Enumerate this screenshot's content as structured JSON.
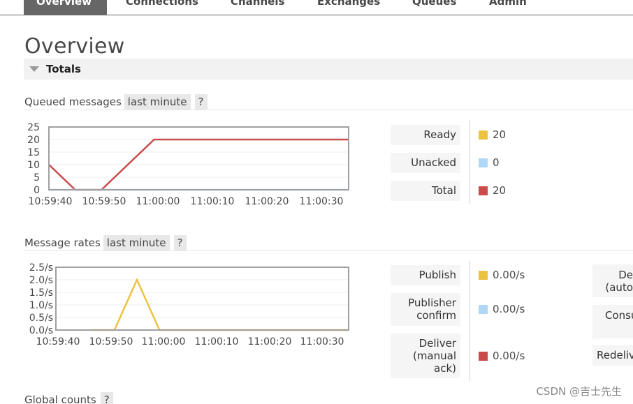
{
  "nav": {
    "tabs": [
      {
        "label": "Overview",
        "active": true
      },
      {
        "label": "Connections"
      },
      {
        "label": "Channels"
      },
      {
        "label": "Exchanges"
      },
      {
        "label": "Queues"
      },
      {
        "label": "Admin"
      }
    ]
  },
  "page": {
    "title": "Overview"
  },
  "totals": {
    "label": "Totals"
  },
  "queued": {
    "heading": "Queued messages",
    "range": "last minute",
    "help": "?",
    "legend": [
      {
        "label": "Ready",
        "value": "20",
        "color": "#edc240"
      },
      {
        "label": "Unacked",
        "value": "0",
        "color": "#afd8f8"
      },
      {
        "label": "Total",
        "value": "20",
        "color": "#cb4b4b"
      }
    ]
  },
  "rates": {
    "heading": "Message rates",
    "range": "last minute",
    "help": "?",
    "legend": [
      {
        "label": "Publish",
        "value": "0.00/s",
        "color": "#edc240"
      },
      {
        "label": "Publisher confirm",
        "label_lines": [
          "Publisher",
          "confirm"
        ],
        "value": "0.00/s",
        "color": "#afd8f8"
      },
      {
        "label": "Deliver (manual ack)",
        "label_lines": [
          "Deliver",
          "(manual",
          "ack)"
        ],
        "value": "0.00/s",
        "color": "#cb4b4b"
      }
    ],
    "cutoff_labels": [
      "De",
      "(auto",
      "Consu",
      "Redeliv"
    ]
  },
  "global": {
    "heading": "Global counts",
    "help": "?"
  },
  "watermark": "CSDN @吉士先生",
  "chart_data": [
    {
      "type": "line",
      "title": "Queued messages",
      "x": [
        "10:59:40",
        "10:59:45",
        "10:59:50",
        "11:00:00",
        "11:00:10",
        "11:00:20",
        "11:00:30",
        "11:00:37"
      ],
      "x_ticks": [
        "10:59:40",
        "10:59:50",
        "11:00:00",
        "11:00:10",
        "11:00:20",
        "11:00:30"
      ],
      "y_ticks": [
        "25",
        "20",
        "15",
        "10",
        "5",
        "0"
      ],
      "ylim": [
        0,
        25
      ],
      "series": [
        {
          "name": "Total",
          "color": "#cb4b4b",
          "points": [
            [
              "10:59:40",
              10
            ],
            [
              "10:59:45",
              0
            ],
            [
              "10:59:50",
              0
            ],
            [
              "11:00:00",
              20
            ],
            [
              "11:00:37",
              20
            ]
          ]
        },
        {
          "name": "Unacked",
          "color": "#afd8f8",
          "points": [
            [
              "10:59:40",
              0
            ],
            [
              "11:00:37",
              0
            ]
          ]
        }
      ],
      "grid": true
    },
    {
      "type": "line",
      "title": "Message rates",
      "x_ticks": [
        "10:59:40",
        "10:59:50",
        "11:00:00",
        "11:00:10",
        "11:00:20",
        "11:00:30"
      ],
      "y_ticks": [
        "2.5/s",
        "2.0/s",
        "1.5/s",
        "1.0/s",
        "0.5/s",
        "0.0/s"
      ],
      "ylim": [
        0,
        2.5
      ],
      "series": [
        {
          "name": "Publish",
          "color": "#edc240",
          "points": [
            [
              "10:59:40",
              0
            ],
            [
              "10:59:45",
              0
            ],
            [
              "10:59:50",
              2.0
            ],
            [
              "10:59:55",
              0
            ],
            [
              "11:00:37",
              0
            ]
          ]
        }
      ],
      "grid": true
    }
  ]
}
